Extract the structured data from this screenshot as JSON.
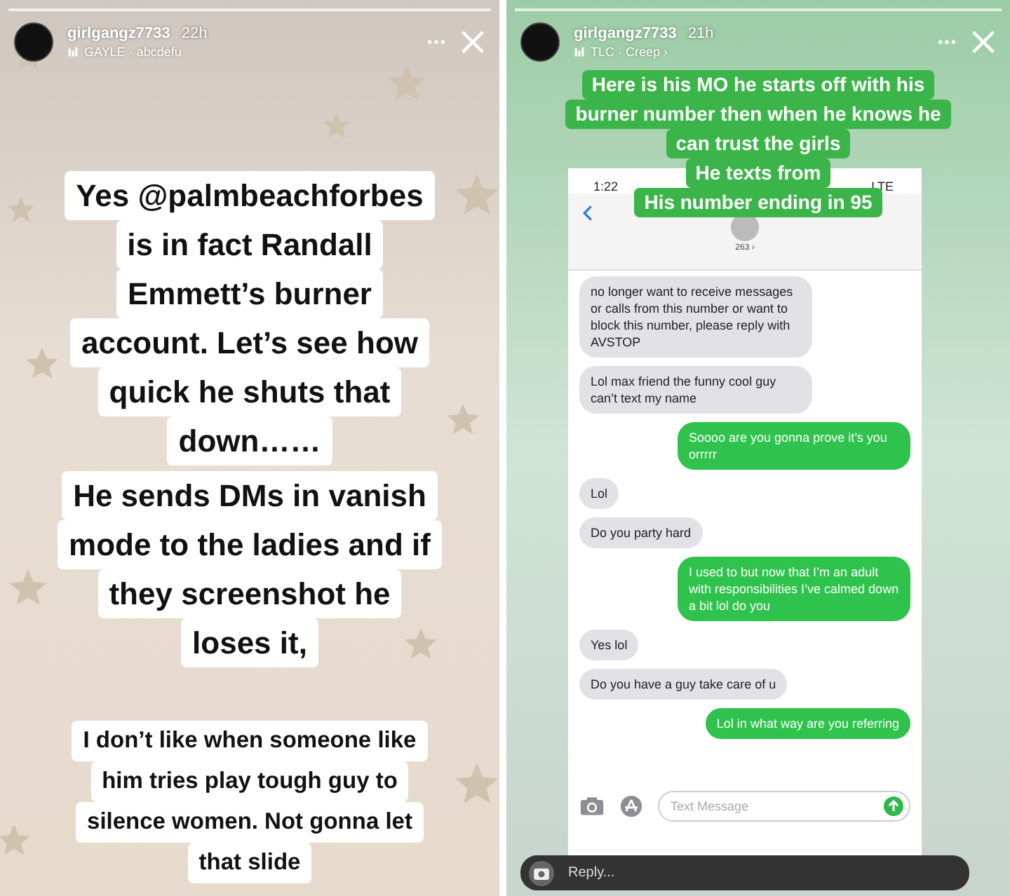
{
  "stories": [
    {
      "username": "girlgangz7733",
      "time": "22h",
      "music": "GAYLE · abcdefu",
      "texts": [
        {
          "kind": "large",
          "lines": [
            "Yes **@palmbeachforbes**",
            "is in fact Randall",
            "Emmett’s burner",
            "account. Let’s see how",
            "quick he shuts that",
            "down……"
          ]
        },
        {
          "kind": "large",
          "lines": [
            "He sends DMs in vanish",
            "mode to the ladies and if",
            "they screenshot he",
            "loses it,"
          ]
        },
        {
          "kind": "small",
          "lines": [
            "I don’t like when someone like",
            "him tries play tough guy to",
            "silence women. Not gonna let",
            "that slide"
          ]
        }
      ]
    },
    {
      "username": "girlgangz7733",
      "time": "21h",
      "music": "TLC · Creep ›",
      "captions": [
        "Here is his MO he starts off with his",
        "burner number then when he knows he",
        "can trust the girls",
        "He texts from",
        "His number ending in 95"
      ],
      "screenshot": {
        "time": "1:22",
        "network": "LTE",
        "contact": "263 ›",
        "messages": [
          {
            "kind": "incoming",
            "text": "no longer want to receive messages or calls from this number or want to block this number, please reply with AVSTOP"
          },
          {
            "kind": "incoming",
            "text": "Lol max friend the funny cool guy can’t text my name"
          },
          {
            "kind": "outgoing",
            "text": "Soooo are you gonna prove it’s you orrrrr"
          },
          {
            "kind": "incoming",
            "text": "Lol"
          },
          {
            "kind": "incoming",
            "text": "Do you party hard"
          },
          {
            "kind": "outgoing",
            "text": "I used to but now that I’m an adult with responsibilities I’ve calmed down a bit lol do you"
          },
          {
            "kind": "incoming",
            "text": "Yes lol"
          },
          {
            "kind": "incoming",
            "text": "Do you have a guy take care of u"
          },
          {
            "kind": "outgoing",
            "text": "Lol in what way are you referring"
          }
        ],
        "input_placeholder": "Text Message"
      },
      "reply_placeholder": "Reply..."
    }
  ]
}
